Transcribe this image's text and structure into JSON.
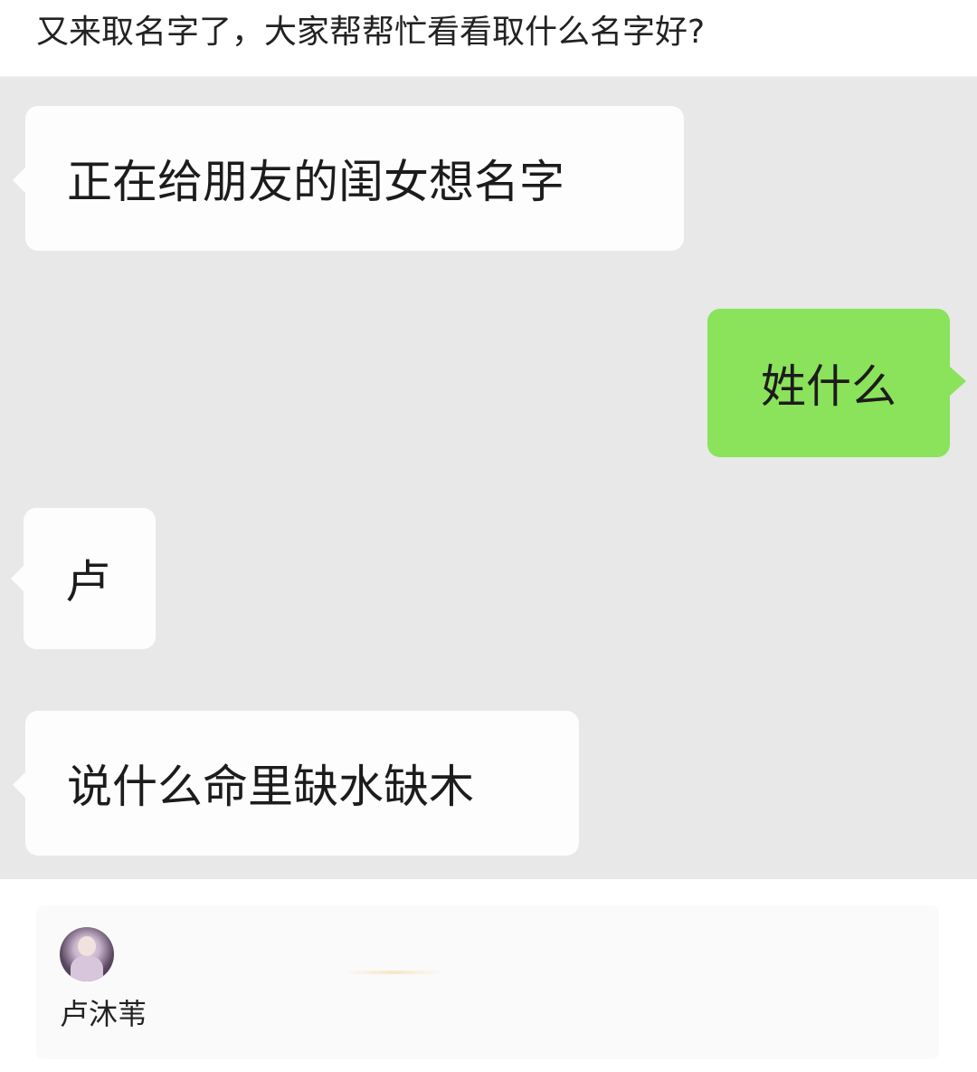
{
  "post": {
    "title": "又来取名字了，大家帮帮忙看看取什么名字好?"
  },
  "chat": {
    "messages": [
      {
        "side": "incoming",
        "text": "正在给朋友的闺女想名字"
      },
      {
        "side": "outgoing",
        "text": "姓什么"
      },
      {
        "side": "incoming",
        "text": "卢"
      },
      {
        "side": "incoming",
        "text": "说什么命里缺水缺木"
      }
    ],
    "colors": {
      "background": "#e8e8e8",
      "incoming_bubble": "#fdfdfd",
      "outgoing_bubble": "#8be25b"
    }
  },
  "comment_card": {
    "avatar_icon": "user-avatar",
    "username": "卢沐苇"
  }
}
